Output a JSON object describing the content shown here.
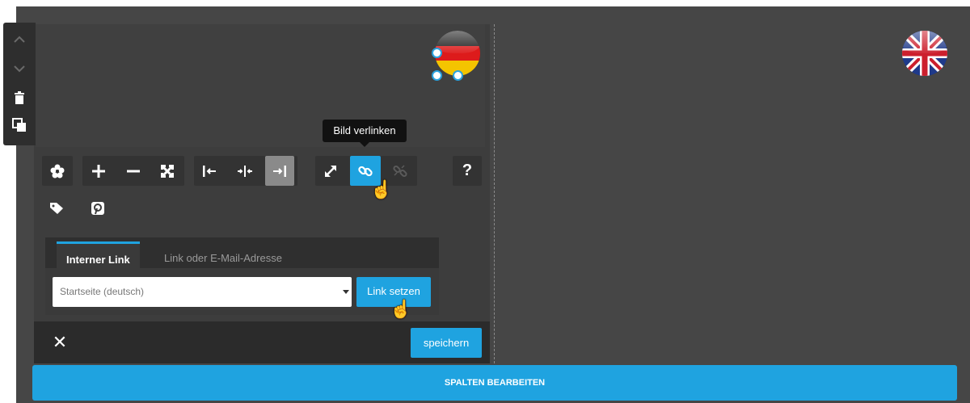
{
  "side_toolbar": {
    "icons": [
      "chevron-up-icon",
      "chevron-down-icon",
      "trash-icon",
      "copy-icon"
    ]
  },
  "flags": {
    "left": "german-flag",
    "right": "uk-flag"
  },
  "tooltip": {
    "text": "Bild verlinken"
  },
  "toolbar": {
    "help_label": "?",
    "icons": [
      "flower-icon",
      "plus-icon",
      "minus-icon",
      "expand-icon",
      "align-left-icon",
      "align-center-icon",
      "align-right-icon",
      "resize-icon",
      "link-icon",
      "unlink-icon",
      "help-icon",
      "tag-icon",
      "pinterest-icon"
    ]
  },
  "link_panel": {
    "tabs": [
      {
        "label": "Interner Link",
        "active": true
      },
      {
        "label": "Link oder E-Mail-Adresse",
        "active": false
      }
    ],
    "select_value": "Startseite (deutsch)",
    "set_link_label": "Link setzen"
  },
  "footer": {
    "close_label": "✕",
    "save_label": "speichern"
  },
  "edit_columns_label": "SPALTEN BEARBEITEN",
  "colors": {
    "accent": "#1fa3e0",
    "canvas": "#464646",
    "panel": "#3d3d3d",
    "toolbar_group": "#333333"
  }
}
